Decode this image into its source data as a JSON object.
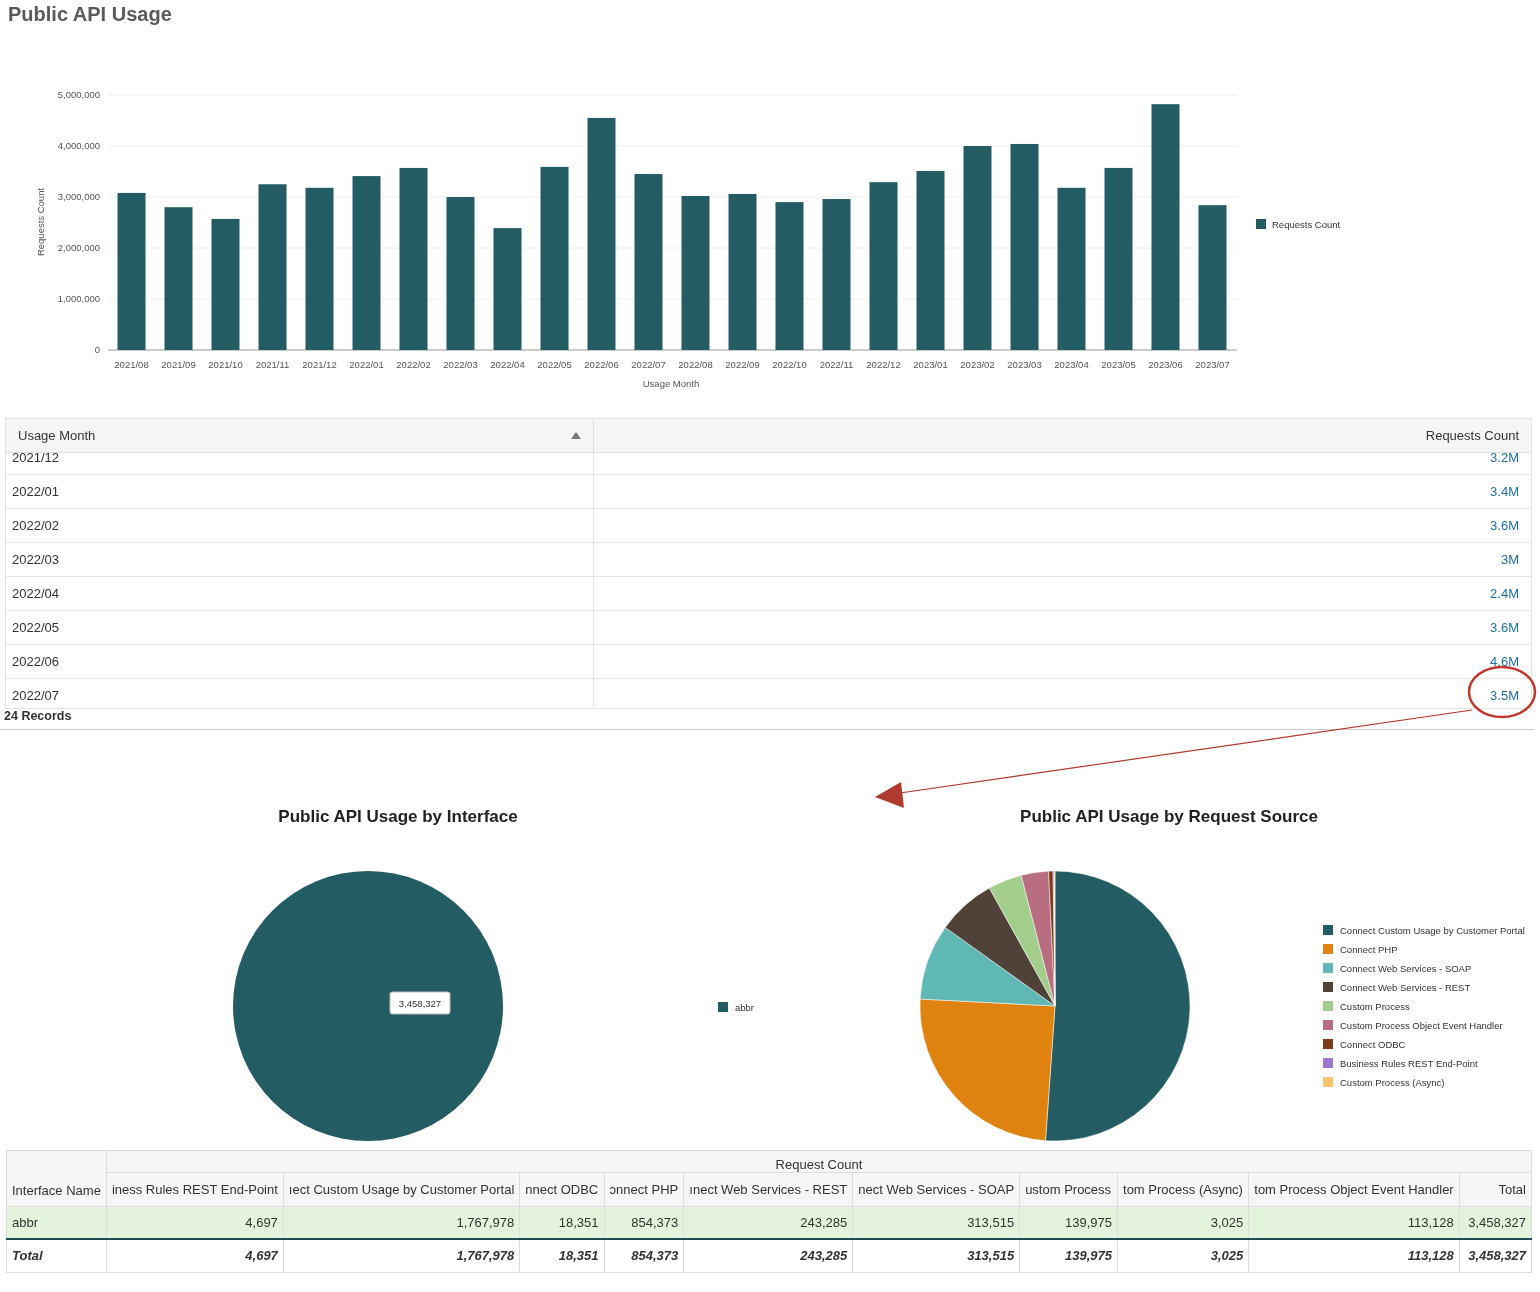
{
  "title": "Public API Usage",
  "bar_chart": {
    "chart_data": {
      "type": "bar",
      "grid": true,
      "legend": "right",
      "xlabel": "Usage Month",
      "ylabel": "Requests Count",
      "ylim": [
        0,
        5000000
      ],
      "yticks": [
        {
          "value": 0,
          "label": "0"
        },
        {
          "value": 1000000,
          "label": "1,000,000"
        },
        {
          "value": 2000000,
          "label": "2,000,000"
        },
        {
          "value": 3000000,
          "label": "3,000,000"
        },
        {
          "value": 4000000,
          "label": "4,000,000"
        },
        {
          "value": 5000000,
          "label": "5,000,000"
        }
      ],
      "categories": [
        "2021/08",
        "2021/09",
        "2021/10",
        "2021/11",
        "2021/12",
        "2022/01",
        "2022/02",
        "2022/03",
        "2022/04",
        "2022/05",
        "2022/06",
        "2022/07",
        "2022/08",
        "2022/09",
        "2022/10",
        "2022/11",
        "2022/12",
        "2023/01",
        "2023/02",
        "2023/03",
        "2023/04",
        "2023/05",
        "2023/06",
        "2023/07"
      ],
      "series": [
        {
          "name": "Requests Count",
          "color": "#235d63",
          "values": [
            3080000,
            2800000,
            2570000,
            3250000,
            3180000,
            3410000,
            3570000,
            3000000,
            2390000,
            3590000,
            4550000,
            3450000,
            3020000,
            3060000,
            2900000,
            2960000,
            3290000,
            3510000,
            4000000,
            4040000,
            3180000,
            3570000,
            4820000,
            2840000
          ]
        }
      ]
    }
  },
  "table": {
    "columns": [
      {
        "label": "Usage Month",
        "sorted": true
      },
      {
        "label": "Requests Count",
        "sorted": false
      }
    ],
    "rows": [
      {
        "month": "2021/12",
        "count": "3.2M"
      },
      {
        "month": "2022/01",
        "count": "3.4M"
      },
      {
        "month": "2022/02",
        "count": "3.6M"
      },
      {
        "month": "2022/03",
        "count": "3M"
      },
      {
        "month": "2022/04",
        "count": "2.4M"
      },
      {
        "month": "2022/05",
        "count": "3.6M"
      },
      {
        "month": "2022/06",
        "count": "4.6M"
      },
      {
        "month": "2022/07",
        "count": "3.5M"
      }
    ],
    "record_count": "24 Records"
  },
  "pie_charts": [
    {
      "chart_data": {
        "type": "pie",
        "title": "Public API Usage by Interface",
        "legend": "right",
        "categories": [
          "abbr"
        ],
        "colors": [
          "#235d63"
        ],
        "values": [
          3458327
        ],
        "value_labels": [
          "3,458,327"
        ]
      }
    },
    {
      "chart_data": {
        "type": "pie",
        "title": "Public API Usage by Request Source",
        "legend": "right",
        "categories": [
          "Connect Custom Usage by Customer Portal",
          "Connect PHP",
          "Connect Web Services - SOAP",
          "Connect Web Services - REST",
          "Custom Process",
          "Custom Process Object Event Handler",
          "Connect ODBC",
          "Business Rules REST End-Point",
          "Custom Process (Async)"
        ],
        "colors": [
          "#235d63",
          "#e0820f",
          "#5fb8b4",
          "#4f4239",
          "#a3cd8b",
          "#b96d80",
          "#7e3b17",
          "#9b7ad0",
          "#fbc36b"
        ],
        "values": [
          51.12,
          24.7,
          9.07,
          7.03,
          4.05,
          3.27,
          0.53,
          0.14,
          0.09
        ]
      }
    }
  ],
  "pivot": {
    "row_header": "Interface Name",
    "group_header": "Request Count",
    "columns": [
      "iness Rules REST End-Point",
      "ıect Custom Usage by Customer Portal",
      "nnect ODBC",
      "ɔnnect PHP",
      "ınect Web Services - REST",
      "nect Web Services - SOAP",
      "ustom Process",
      "tom Process (Async)",
      "tom Process Object Event Handler",
      "Total"
    ],
    "rows": [
      {
        "name": "abbr",
        "values": [
          "4,697",
          "1,767,978",
          "18,351",
          "854,373",
          "243,285",
          "313,515",
          "139,975",
          "3,025",
          "113,128",
          "3,458,327"
        ]
      }
    ],
    "total": {
      "label": "Total",
      "values": [
        "4,697",
        "1,767,978",
        "18,351",
        "854,373",
        "243,285",
        "313,515",
        "139,975",
        "3,025",
        "113,128",
        "3,458,327"
      ]
    }
  }
}
